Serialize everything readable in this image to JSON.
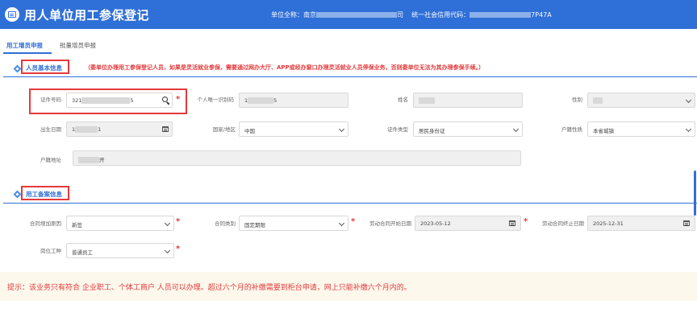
{
  "header": {
    "app_title": "用人单位用工参保登记",
    "unit_name_label": "单位全称：",
    "unit_name_prefix": "南京",
    "unit_name_suffix": "司",
    "credit_code_label": "统一社会信用代码：",
    "credit_code_suffix": "7P47A"
  },
  "tabs": [
    {
      "label": "用工增员申报",
      "active": true
    },
    {
      "label": "批量增员申报",
      "active": false
    }
  ],
  "section_personal": {
    "title": "人员基本信息",
    "notice": "（委单位办理用工参保登记人员，如果是灵活就业参保，需要通过网办大厅、APP或经办窗口办理灵活就业人员停保业务，否则委单位无法为其办理参保手续。）"
  },
  "fields_personal": {
    "id_number_label": "证件号码",
    "id_number_prefix": "321",
    "id_number_suffix": "5",
    "person_unique_id_label": "个人唯一识别码",
    "person_unique_id_prefix": "1",
    "person_unique_id_suffix": "5",
    "name_label": "姓名",
    "gender_label": "性别",
    "birth_date_label": "出生日期",
    "birth_date_prefix": "1",
    "birth_date_suffix": "1",
    "nationality_label": "国家/地区",
    "nationality_value": "中国",
    "id_type_label": "证件类型",
    "id_type_value": "居民身份证",
    "household_type_label": "户籍性质",
    "household_type_value": "本省城镇",
    "household_address_label": "户籍地址",
    "household_address_suffix": "开"
  },
  "section_employment": {
    "title": "用工备案信息"
  },
  "fields_employment": {
    "contract_reason_label": "合同增加原因",
    "contract_reason_value": "新签",
    "contract_type_label": "合同类别",
    "contract_type_value": "固定期限",
    "contract_start_label": "劳动合同开始日期",
    "contract_start_value": "2023-05-12",
    "contract_end_label": "劳动合同终止日期",
    "contract_end_value": "2025-12-31",
    "job_type_label": "岗位工种",
    "job_type_value": "普通员工"
  },
  "tip": {
    "text": "提示：该业务只有符合 企业职工、个体工商户 人员可以办理。超过六个月的补缴需要到柜台申请，网上只能补缴六个月内的。"
  },
  "colors": {
    "header_bg": "#2f6fd8",
    "accent": "#2f6fd8",
    "required": "#e4393c",
    "tip_bg": "#fdf8ec"
  },
  "icons": [
    "form-icon",
    "search-icon",
    "calendar-icon",
    "chevron-down-icon",
    "diamond-icon"
  ]
}
